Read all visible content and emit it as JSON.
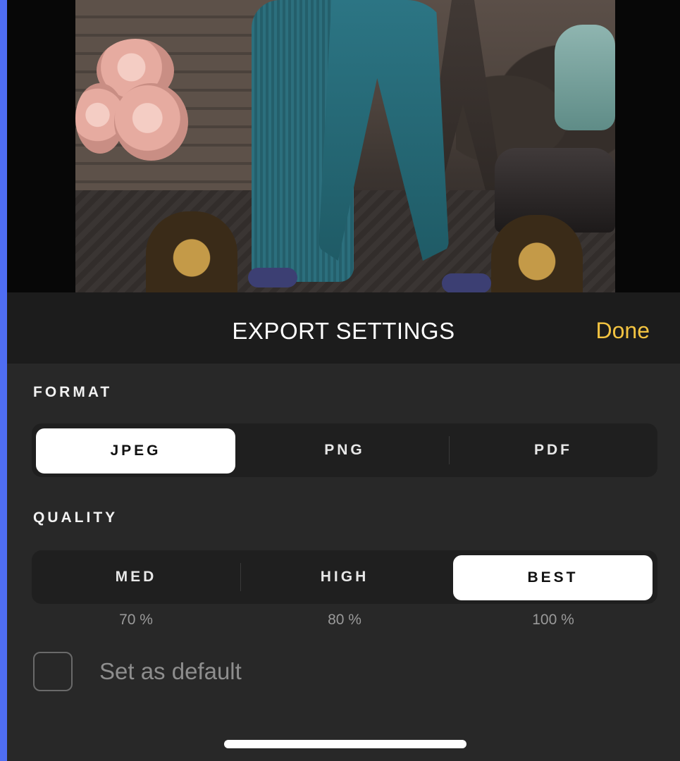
{
  "header": {
    "title": "EXPORT SETTINGS",
    "done_label": "Done"
  },
  "format": {
    "label": "FORMAT",
    "options": [
      "JPEG",
      "PNG",
      "PDF"
    ],
    "selected": "JPEG"
  },
  "quality": {
    "label": "QUALITY",
    "options": [
      {
        "label": "MED",
        "percent": "70 %"
      },
      {
        "label": "HIGH",
        "percent": "80 %"
      },
      {
        "label": "BEST",
        "percent": "100 %"
      }
    ],
    "selected": "BEST"
  },
  "default_checkbox": {
    "label": "Set as default",
    "checked": false
  },
  "colors": {
    "accent": "#f2c341",
    "edge_strip": "#4f6df2",
    "panel_bg": "#282828",
    "header_bg": "#1c1c1c",
    "selected_segment": "#ffffff"
  }
}
